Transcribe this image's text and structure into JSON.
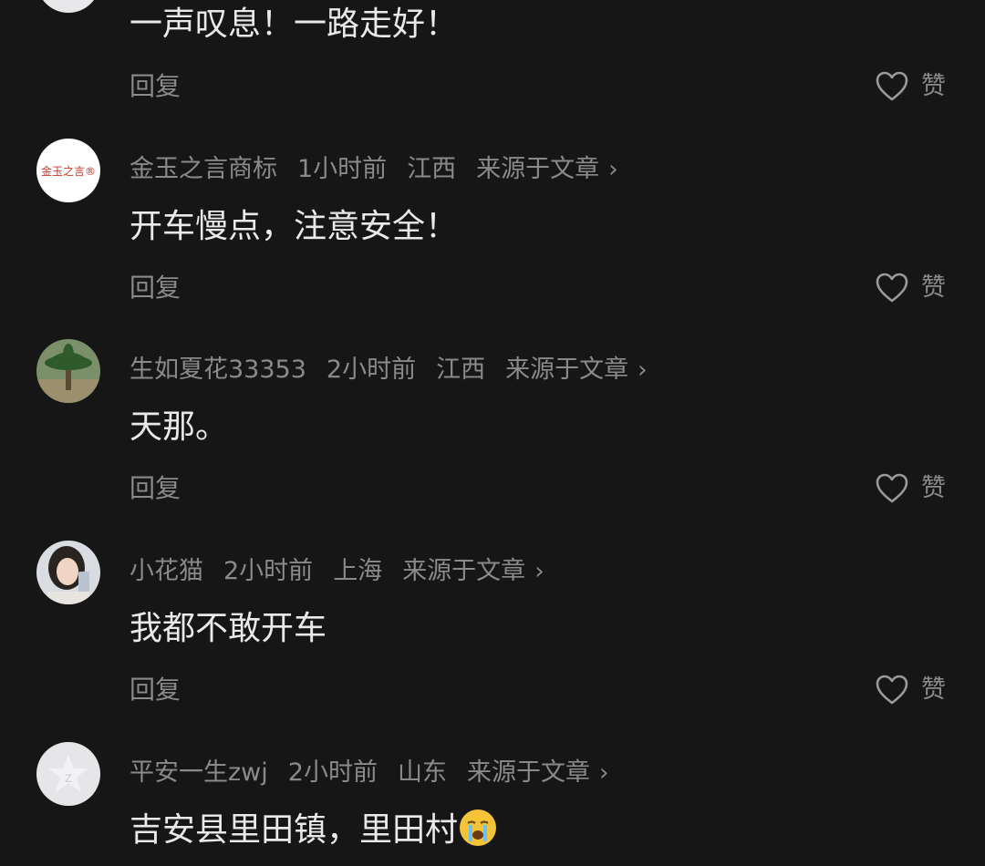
{
  "comments": [
    {
      "name": "",
      "time": "",
      "location": "",
      "source": "",
      "content": "一声叹息！一路走好！",
      "reply_label": "回复",
      "like_label": "赞"
    },
    {
      "name": "金玉之言商标",
      "time": "1小时前",
      "location": "江西",
      "source": "来源于文章",
      "content": "开车慢点，注意安全！",
      "reply_label": "回复",
      "like_label": "赞",
      "avatar_text": "金玉之言®"
    },
    {
      "name": "生如夏花33353",
      "time": "2小时前",
      "location": "江西",
      "source": "来源于文章",
      "content": "天那。",
      "reply_label": "回复",
      "like_label": "赞"
    },
    {
      "name": "小花猫",
      "time": "2小时前",
      "location": "上海",
      "source": "来源于文章",
      "content": "我都不敢开车",
      "reply_label": "回复",
      "like_label": "赞"
    },
    {
      "name": "平安一生zwj",
      "time": "2小时前",
      "location": "山东",
      "source": "来源于文章",
      "content": "吉安县里田镇，里田村",
      "emoji": "crying-face-emoji"
    }
  ],
  "colors": {
    "background": "#161616",
    "primary_text": "#e9e9e9",
    "secondary_text": "#8a8a8a"
  }
}
